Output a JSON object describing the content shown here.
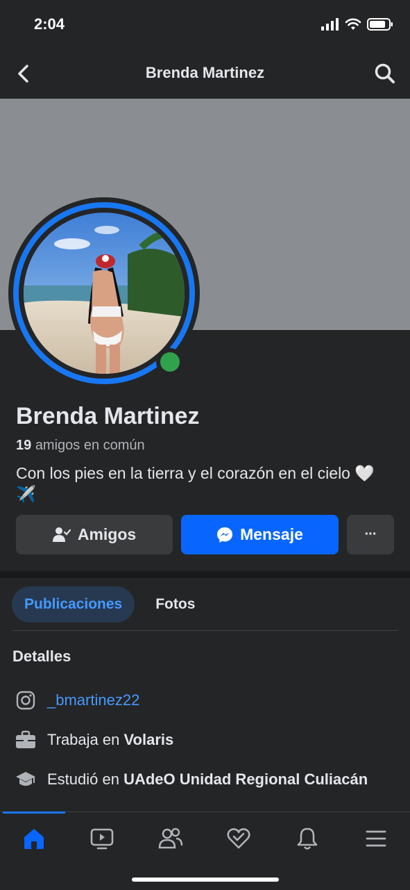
{
  "status_bar": {
    "time": "2:04"
  },
  "header": {
    "title": "Brenda Martinez"
  },
  "profile": {
    "name": "Brenda Martinez",
    "mutual_count": "19",
    "mutual_text": "amigos en común",
    "bio": "Con los pies en la tierra y el corazón en el cielo 🤍 ✈️"
  },
  "actions": {
    "friends_label": "Amigos",
    "message_label": "Mensaje",
    "more_label": "···"
  },
  "tabs": [
    {
      "label": "Publicaciones",
      "active": true
    },
    {
      "label": "Fotos",
      "active": false
    }
  ],
  "details": {
    "title": "Detalles",
    "instagram": "_bmartinez22",
    "work_prefix": "Trabaja en",
    "work_place": "Volaris",
    "study_prefix": "Estudió en",
    "study_place": "UAdeO Unidad Regional Culiacán"
  },
  "colors": {
    "accent": "#0866ff",
    "link": "#4599ff",
    "online": "#31a24c",
    "background": "#242526"
  },
  "bottom_nav": [
    "home-icon",
    "video-icon",
    "friends-icon",
    "dating-heart-icon",
    "bell-icon",
    "menu-icon"
  ]
}
